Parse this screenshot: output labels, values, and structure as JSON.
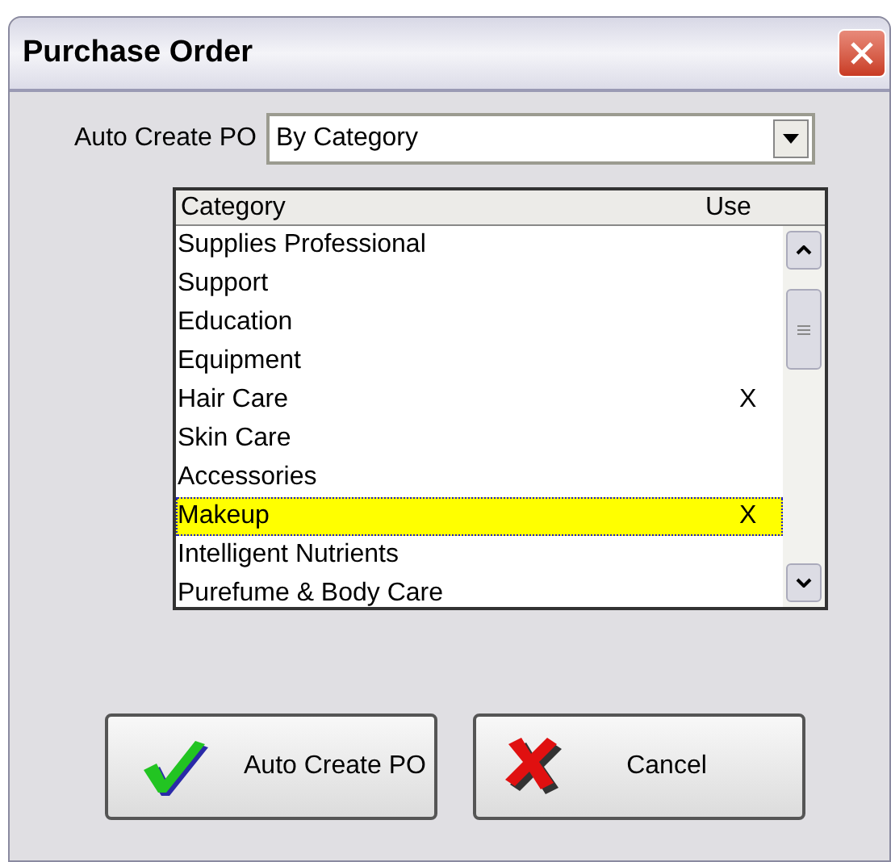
{
  "window": {
    "title": "Purchase Order"
  },
  "auto_create": {
    "label": "Auto Create PO",
    "value": "By Category"
  },
  "table": {
    "columns": [
      "Category",
      "Use"
    ],
    "rows": [
      {
        "category": "Supplies Professional",
        "selected": false
      },
      {
        "category": "Support",
        "selected": false
      },
      {
        "category": "Education",
        "selected": false
      },
      {
        "category": "Equipment",
        "selected": false
      },
      {
        "category": "Hair Care",
        "use": "X",
        "selected": false
      },
      {
        "category": "Skin Care",
        "selected": false
      },
      {
        "category": "Accessories",
        "selected": false
      },
      {
        "category": "Makeup",
        "use": "X",
        "selected": true
      },
      {
        "category": "Intelligent Nutrients",
        "selected": false
      },
      {
        "category": "Purefume & Body Care",
        "selected": false
      }
    ]
  },
  "buttons": [
    {
      "kind": "ok",
      "label": "Auto Create PO"
    },
    {
      "kind": "cancel",
      "label": "Cancel"
    }
  ]
}
